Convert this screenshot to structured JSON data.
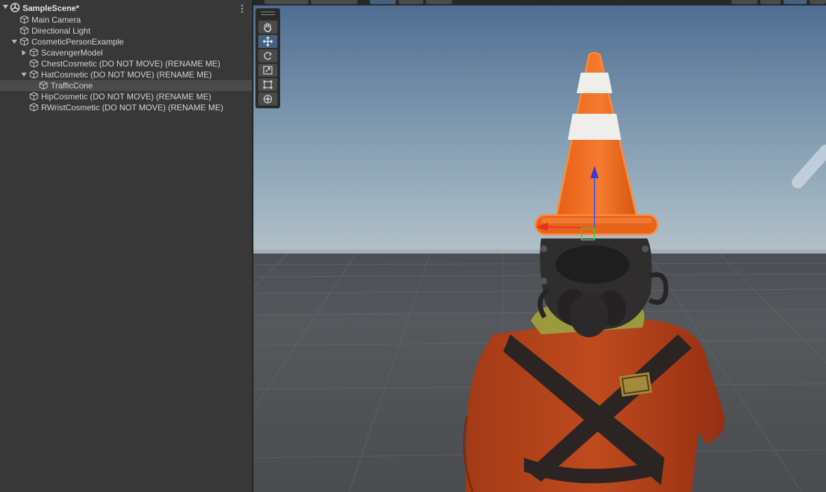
{
  "hierarchy": {
    "scene_name": "SampleScene*",
    "menu_glyph": "⋮",
    "items": [
      {
        "label": "Main Camera"
      },
      {
        "label": "Directional Light"
      },
      {
        "label": "CosmeticPersonExample"
      },
      {
        "label": "ScavengerModel"
      },
      {
        "label": "ChestCosmetic (DO NOT MOVE) (RENAME ME)"
      },
      {
        "label": "HatCosmetic (DO NOT MOVE) (RENAME ME)"
      },
      {
        "label": "TrafficCone"
      },
      {
        "label": "HipCosmetic (DO NOT MOVE) (RENAME ME)"
      },
      {
        "label": "RWristCosmetic (DO NOT MOVE) (RENAME ME)"
      }
    ],
    "selected_item": "TrafficCone"
  },
  "scene_tools": [
    {
      "name": "hand-tool",
      "active": false
    },
    {
      "name": "move-tool",
      "active": true
    },
    {
      "name": "rotate-tool",
      "active": false
    },
    {
      "name": "scale-tool",
      "active": false
    },
    {
      "name": "rect-tool",
      "active": false
    },
    {
      "name": "transform-tool",
      "active": false
    }
  ],
  "colors": {
    "panel_bg": "#383838",
    "selection_bg": "#4a4a4a",
    "active_tool": "#46607e",
    "cone_orange": "#ee6a1e",
    "suit_orange": "#b7401c"
  }
}
